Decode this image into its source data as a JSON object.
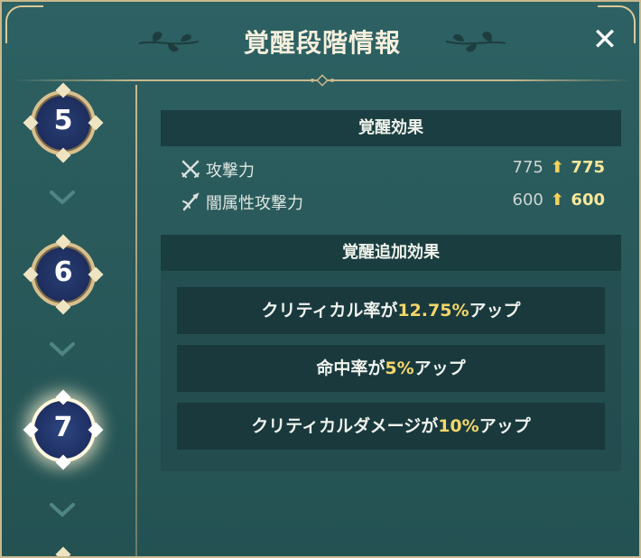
{
  "header": {
    "title": "覚醒段階情報",
    "close_label": "✕"
  },
  "stages": [
    {
      "number": "5",
      "active": false
    },
    {
      "number": "6",
      "active": false
    },
    {
      "number": "7",
      "active": true
    }
  ],
  "effects": {
    "heading": "覚醒効果",
    "stats": [
      {
        "icon": "crossed-swords-icon",
        "label": "攻撃力",
        "old": "775",
        "new": "775"
      },
      {
        "icon": "dark-sword-icon",
        "label": "闇属性攻撃力",
        "old": "600",
        "new": "600"
      }
    ]
  },
  "bonus": {
    "heading": "覚醒追加効果",
    "items": [
      {
        "pre": "クリティカル率が",
        "value": "12.75%",
        "post": "アップ"
      },
      {
        "pre": "命中率が",
        "value": "5%",
        "post": "アップ"
      },
      {
        "pre": "クリティカルダメージが",
        "value": "10%",
        "post": "アップ"
      }
    ]
  },
  "colors": {
    "accent_gold": "#f3d66a",
    "frame_gold": "#c9b98d",
    "panel_teal": "#2d6163",
    "stage_navy": "#1c2c5c"
  }
}
